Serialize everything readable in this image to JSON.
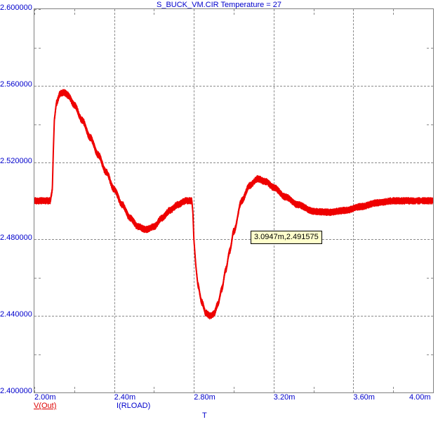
{
  "title": "S_BUCK_VM.CIR Temperature = 27",
  "tooltip": {
    "text": "3.0947m,2.491575"
  },
  "legends": {
    "vout": "V(Out)",
    "irload": "I(RLOAD)",
    "t": "T"
  },
  "axes": {
    "y": {
      "labels": [
        "2.600000",
        "2.560000",
        "2.520000",
        "2.480000",
        "2.440000",
        "2.400000"
      ],
      "min": 2.4,
      "max": 2.6
    },
    "x": {
      "labels": [
        "2.00m",
        "2.40m",
        "2.80m",
        "3.20m",
        "3.60m",
        "4.00m"
      ],
      "min": 2.0,
      "max": 4.0,
      "unit": "m"
    }
  },
  "colors": {
    "trace": "#ee0000",
    "axis_text": "#0000cc",
    "grid": "#8a8a8a",
    "frame": "#808080",
    "tooltip_bg": "#ffffcc"
  },
  "chart_data": {
    "type": "line",
    "title": "S_BUCK_VM.CIR Temperature = 27",
    "xlabel": "T",
    "ylabel": "V(Out)",
    "xlim": [
      0.002,
      0.004
    ],
    "ylim": [
      2.4,
      2.6
    ],
    "grid": true,
    "legend_position": "bottom-left",
    "xtick_labels": [
      "2.00m",
      "2.40m",
      "2.80m",
      "3.20m",
      "3.60m",
      "4.00m"
    ],
    "xticks": [
      0.002,
      0.0024,
      0.0028,
      0.0032,
      0.0036,
      0.004
    ],
    "ytick_labels": [
      "2.400000",
      "2.440000",
      "2.480000",
      "2.520000",
      "2.560000",
      "2.600000"
    ],
    "yticks": [
      2.4,
      2.44,
      2.48,
      2.52,
      2.56,
      2.6
    ],
    "annotations": [
      {
        "text": "3.0947m,2.491575",
        "x": 0.0030947,
        "y": 2.491575
      }
    ],
    "series": [
      {
        "name": "V(Out)",
        "color": "#ee0000",
        "noise_amplitude": 0.0018,
        "x": [
          0.002,
          0.00205,
          0.00208,
          0.00209,
          0.002095,
          0.0021,
          0.00211,
          0.00213,
          0.00215,
          0.00217,
          0.0022,
          0.00224,
          0.00228,
          0.00232,
          0.00236,
          0.0024,
          0.00244,
          0.00248,
          0.00252,
          0.00256,
          0.0026,
          0.00264,
          0.00268,
          0.00272,
          0.00276,
          0.00279,
          0.002795,
          0.0028,
          0.00281,
          0.00282,
          0.00284,
          0.00286,
          0.00288,
          0.0029,
          0.00292,
          0.00294,
          0.00296,
          0.00298,
          0.003,
          0.00304,
          0.00308,
          0.00312,
          0.00316,
          0.0032,
          0.00326,
          0.00332,
          0.0034,
          0.00348,
          0.00356,
          0.00364,
          0.00372,
          0.0038,
          0.0039,
          0.004
        ],
        "y": [
          2.5,
          2.5,
          2.5,
          2.506,
          2.526,
          2.542,
          2.551,
          2.556,
          2.5565,
          2.555,
          2.55,
          2.542,
          2.533,
          2.524,
          2.515,
          2.506,
          2.498,
          2.491,
          2.4865,
          2.485,
          2.4865,
          2.491,
          2.495,
          2.498,
          2.5,
          2.5,
          2.494,
          2.48,
          2.466,
          2.456,
          2.447,
          2.4415,
          2.44,
          2.441,
          2.446,
          2.454,
          2.464,
          2.474,
          2.484,
          2.5,
          2.508,
          2.5115,
          2.51,
          2.507,
          2.502,
          2.498,
          2.4945,
          2.494,
          2.495,
          2.497,
          2.499,
          2.5,
          2.5,
          2.5
        ]
      }
    ]
  }
}
